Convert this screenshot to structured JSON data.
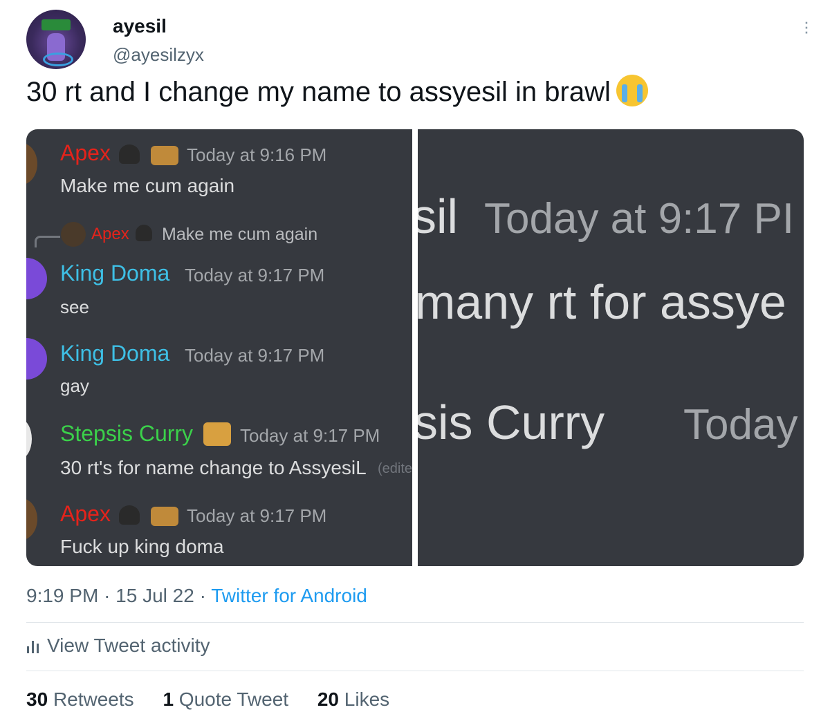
{
  "author": {
    "name": "ayesil",
    "handle": "@ayesilzyx"
  },
  "tweet": {
    "text": "30 rt and I change my name to assyesil in brawl",
    "emoji": "loudly-crying-face-emoji"
  },
  "discord_left": {
    "messages": [
      {
        "user": "Apex",
        "user_color": "#e5231b",
        "time": "Today at 9:16 PM",
        "text": "Make me cum again"
      },
      {
        "reply_user": "Apex",
        "reply_text": "Make me cum again"
      },
      {
        "user": "King Doma",
        "user_color": "#3ec0e6",
        "time": "Today at 9:17 PM",
        "text": "see"
      },
      {
        "user": "King Doma",
        "user_color": "#3ec0e6",
        "time": "Today at 9:17 PM",
        "text": "gay"
      },
      {
        "user": "Stepsis Curry",
        "user_color": "#3bd14a",
        "time": "Today at 9:17 PM",
        "text": "30 rt's for name change to AssyesiL",
        "edited": "(edite"
      },
      {
        "user": "Apex",
        "user_color": "#e5231b",
        "time": "Today at 9:17 PM",
        "text": "Fuck up king doma"
      }
    ]
  },
  "discord_right": {
    "line1_name": "sil",
    "line1_time": "Today at 9:17 PI",
    "line2": "many rt for assye",
    "line3_name": "sis Curry",
    "line3_time": "Today"
  },
  "meta": {
    "time": "9:19 PM",
    "date": "15 Jul 22",
    "source": "Twitter for Android"
  },
  "activity_label": "View Tweet activity",
  "stats": {
    "retweets_count": "30",
    "retweets_label": "Retweets",
    "quotes_count": "1",
    "quotes_label": "Quote Tweet",
    "likes_count": "20",
    "likes_label": "Likes"
  },
  "colors": {
    "discord_bg": "#36393f",
    "link": "#1d9bf0",
    "secondary_text": "#536471"
  }
}
